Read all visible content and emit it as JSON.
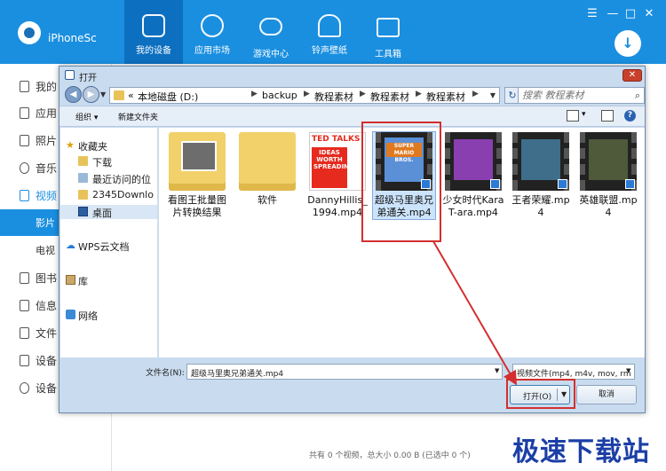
{
  "app": {
    "device_name": "iPhoneSc",
    "nav_tabs": [
      {
        "label": "我的设备",
        "icon": "phone-icon"
      },
      {
        "label": "应用市场",
        "icon": "apps-icon"
      },
      {
        "label": "游戏中心",
        "icon": "gamepad-icon"
      },
      {
        "label": "铃声壁纸",
        "icon": "bell-icon"
      },
      {
        "label": "工具箱",
        "icon": "toolbox-icon"
      }
    ],
    "window_controls": [
      "☰",
      "—",
      "□",
      "✕"
    ],
    "sidebar": [
      {
        "label": "我的"
      },
      {
        "label": "应用"
      },
      {
        "label": "照片"
      },
      {
        "label": "音乐"
      },
      {
        "label": "视频"
      },
      {
        "label": "影片"
      },
      {
        "label": "电视"
      },
      {
        "label": "图书"
      },
      {
        "label": "信息"
      },
      {
        "label": "文件"
      },
      {
        "label": "设备"
      },
      {
        "label": "设备"
      }
    ],
    "status": "共有 0 个视频，总大小 0.00 B (已选中 0 个)",
    "watermark": "极速下载站"
  },
  "dialog": {
    "title": "打开",
    "close_glyph": "✕",
    "address": [
      "本地磁盘 (D:)",
      "backup",
      "教程素材",
      "教程素材",
      "教程素材"
    ],
    "address_prefix": "«",
    "search_placeholder": "搜索 教程素材",
    "toolbar": {
      "organize": "组织 ▾",
      "new_folder": "新建文件夹",
      "help": "?"
    },
    "nav_pane": [
      {
        "label": "收藏夹",
        "icon": "star-icon"
      },
      {
        "label": "下载",
        "icon": "download-folder-icon"
      },
      {
        "label": "最近访问的位",
        "icon": "recent-places-icon"
      },
      {
        "label": "2345Downlo",
        "icon": "folder-icon"
      },
      {
        "label": "桌面",
        "icon": "desktop-icon"
      },
      {
        "label": "WPS云文档",
        "icon": "cloud-icon"
      },
      {
        "label": "库",
        "icon": "library-icon"
      },
      {
        "label": "网络",
        "icon": "network-icon"
      }
    ],
    "files": [
      {
        "name": "看图王批量图片转换结果",
        "type": "folder"
      },
      {
        "name": "软件",
        "type": "folder"
      },
      {
        "name": "DannyHillis_1994.mp4",
        "type": "ted"
      },
      {
        "name": "超级马里奥兄弟通关.mp4",
        "type": "mario"
      },
      {
        "name": "少女时代KaraT-ara.mp4",
        "type": "video"
      },
      {
        "name": "王者荣耀.mp4",
        "type": "video"
      },
      {
        "name": "英雄联盟.mp4",
        "type": "video"
      }
    ],
    "ted": {
      "logo": "TED TALKS",
      "block": "IDEAS WORTH SPREADIN"
    },
    "mario": {
      "title": "SUPER MARIO BROS."
    },
    "filename_label": "文件名(N):",
    "filename_value": "超级马里奥兄弟通关.mp4",
    "filetype_value": "视频文件(mp4, m4v, mov, rm",
    "open_label": "打开(O)",
    "cancel_label": "取消"
  },
  "colors": {
    "accent": "#1a8fe0",
    "highlight_red": "#d32f2f"
  }
}
